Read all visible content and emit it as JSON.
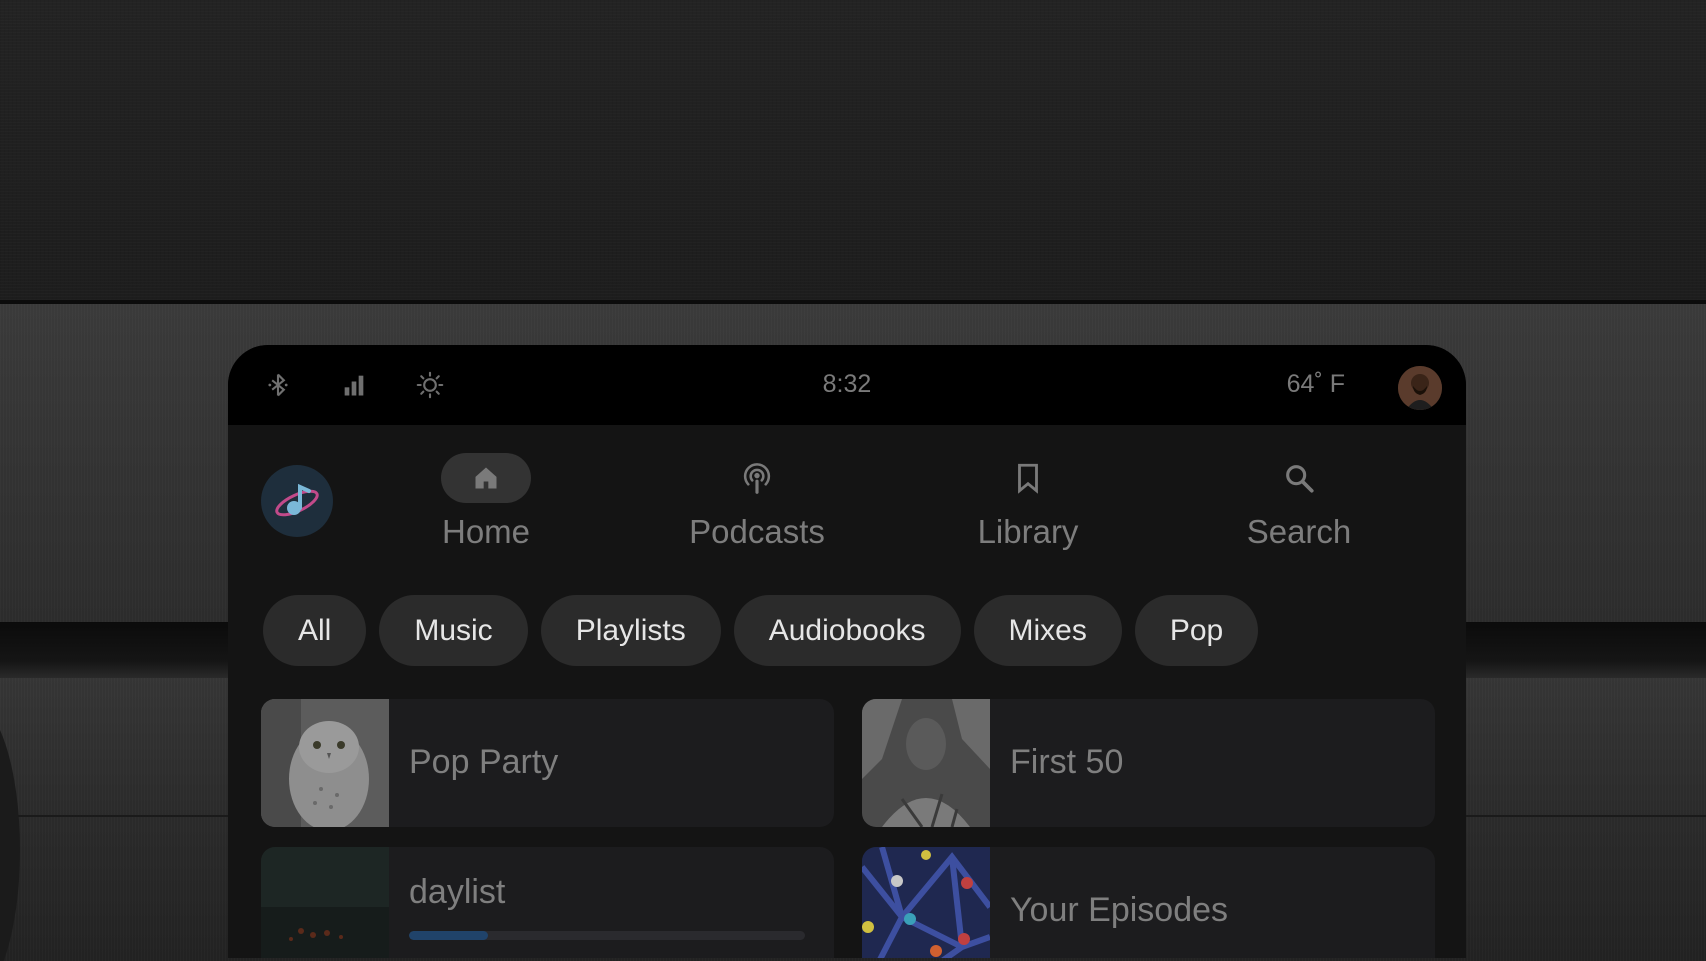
{
  "status_bar": {
    "icons": [
      "bluetooth-icon",
      "signal-icon",
      "brightness-icon"
    ],
    "time": "8:32",
    "temperature": "64˚ F"
  },
  "nav": {
    "items": [
      {
        "label": "Home",
        "icon": "home-icon",
        "active": true
      },
      {
        "label": "Podcasts",
        "icon": "podcast-icon",
        "active": false
      },
      {
        "label": "Library",
        "icon": "bookmark-icon",
        "active": false
      },
      {
        "label": "Search",
        "icon": "search-icon",
        "active": false
      }
    ]
  },
  "filters": [
    "All",
    "Music",
    "Playlists",
    "Audiobooks",
    "Mixes",
    "Pop"
  ],
  "cards": [
    {
      "title": "Pop Party",
      "art": "owl-photo"
    },
    {
      "title": "First 50",
      "art": "portrait-photo"
    },
    {
      "title": "daylist",
      "art": "dark-forest-photo",
      "progress": 0.2
    },
    {
      "title": "Your Episodes",
      "art": "network-pattern"
    }
  ],
  "colors": {
    "screen_bg": "#141414",
    "status_bar_bg": "#000000",
    "chip_bg": "#2b2b2b",
    "card_bg": "#1c1c1e",
    "progress_accent": "#20436a",
    "logo_bg": "#1e2e3c"
  }
}
